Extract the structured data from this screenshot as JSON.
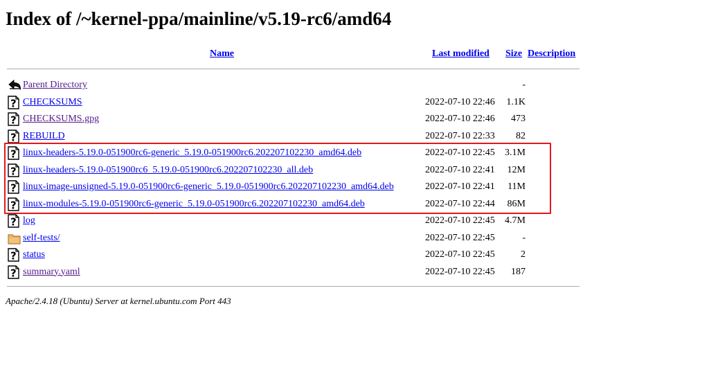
{
  "title": "Index of /~kernel-ppa/mainline/v5.19-rc6/amd64",
  "columns": {
    "name": "Name",
    "last_modified": "Last modified",
    "size": "Size",
    "description": "Description"
  },
  "rows": [
    {
      "icon": "back-icon",
      "name": "Parent Directory",
      "date": "",
      "size": "-"
    },
    {
      "icon": "unknown-file-icon",
      "name": "CHECKSUMS",
      "date": "2022-07-10 22:46",
      "size": "1.1K"
    },
    {
      "icon": "unknown-file-icon",
      "name": "CHECKSUMS.gpg",
      "date": "2022-07-10 22:46",
      "size": "473"
    },
    {
      "icon": "unknown-file-icon",
      "name": "REBUILD",
      "date": "2022-07-10 22:33",
      "size": "82"
    },
    {
      "icon": "unknown-file-icon",
      "name": "linux-headers-5.19.0-051900rc6-generic_5.19.0-051900rc6.202207102230_amd64.deb",
      "date": "2022-07-10 22:45",
      "size": "3.1M"
    },
    {
      "icon": "unknown-file-icon",
      "name": "linux-headers-5.19.0-051900rc6_5.19.0-051900rc6.202207102230_all.deb",
      "date": "2022-07-10 22:41",
      "size": "12M"
    },
    {
      "icon": "unknown-file-icon",
      "name": "linux-image-unsigned-5.19.0-051900rc6-generic_5.19.0-051900rc6.202207102230_amd64.deb",
      "date": "2022-07-10 22:41",
      "size": "11M"
    },
    {
      "icon": "unknown-file-icon",
      "name": "linux-modules-5.19.0-051900rc6-generic_5.19.0-051900rc6.202207102230_amd64.deb",
      "date": "2022-07-10 22:44",
      "size": "86M"
    },
    {
      "icon": "unknown-file-icon",
      "name": "log",
      "date": "2022-07-10 22:45",
      "size": "4.7M"
    },
    {
      "icon": "folder-icon",
      "name": "self-tests/",
      "date": "2022-07-10 22:45",
      "size": "-"
    },
    {
      "icon": "unknown-file-icon",
      "name": "status",
      "date": "2022-07-10 22:45",
      "size": "2"
    },
    {
      "icon": "unknown-file-icon",
      "name": "summary.yaml",
      "date": "2022-07-10 22:45",
      "size": "187"
    }
  ],
  "highlight": {
    "color": "#e8151b",
    "rows": [
      4,
      5,
      6,
      7
    ]
  },
  "colors": {
    "link": "#0000ee",
    "visited_link": "#551a8b"
  },
  "footer": "Apache/2.4.18 (Ubuntu) Server at kernel.ubuntu.com Port 443"
}
